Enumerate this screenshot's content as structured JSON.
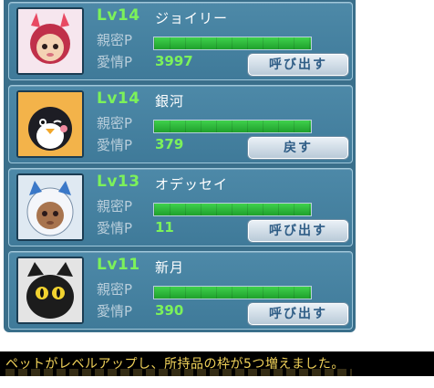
{
  "pets": [
    {
      "level": "Lv14",
      "name": "ジョイリー",
      "intimacy_label": "親密P",
      "intimacy_fill": 1.0,
      "love_label": "愛情P",
      "love_value": "3997",
      "button_label": "呼び出す",
      "portrait_icon": "deer-girl-portrait-icon"
    },
    {
      "level": "Lv14",
      "name": "銀河",
      "intimacy_label": "親密P",
      "intimacy_fill": 1.0,
      "love_label": "愛情P",
      "love_value": "379",
      "button_label": "戻す",
      "portrait_icon": "penguin-portrait-icon"
    },
    {
      "level": "Lv13",
      "name": "オデッセイ",
      "intimacy_label": "親密P",
      "intimacy_fill": 1.0,
      "love_label": "愛情P",
      "love_value": "11",
      "button_label": "呼び出す",
      "portrait_icon": "hooded-boy-portrait-icon"
    },
    {
      "level": "Lv11",
      "name": "新月",
      "intimacy_label": "親密P",
      "intimacy_fill": 1.0,
      "love_label": "愛情P",
      "love_value": "390",
      "button_label": "呼び出す",
      "portrait_icon": "black-cat-portrait-icon"
    }
  ],
  "message": {
    "text": "ペットがレベルアップし、所持品の枠が5つ増えました。"
  },
  "colors": {
    "panel": "#3a6f8b",
    "level_text": "#7cf25a",
    "bar_fill": "#2fbf3c",
    "message_text": "#f2d35a"
  }
}
